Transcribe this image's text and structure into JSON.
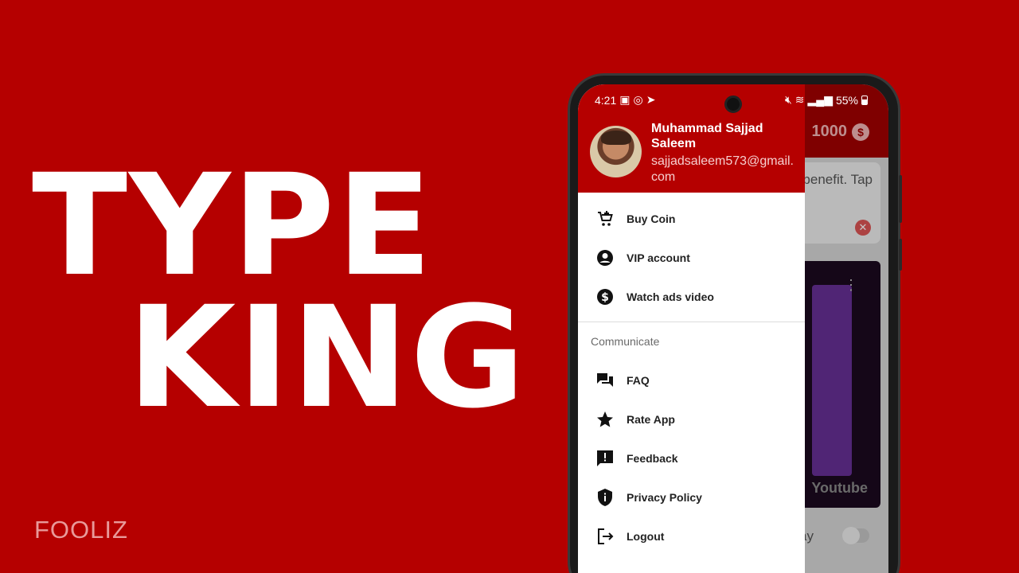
{
  "headline": {
    "line1": "TYPE",
    "line2": "KING"
  },
  "brand": "FOOLIZ",
  "status_bar": {
    "time": "4:21",
    "battery": "55%"
  },
  "background_app": {
    "coin_count": "1000",
    "coin_symbol": "$",
    "notice_text": "benefit. Tap",
    "autoplay_label": "o play",
    "video_channel": "Youtube"
  },
  "drawer": {
    "user": {
      "name": "Muhammad Sajjad Saleem",
      "email": "sajjadsaleem573@gmail.com"
    },
    "items": [
      {
        "label": "Buy Coin",
        "icon": "cart-add-icon"
      },
      {
        "label": "VIP account",
        "icon": "account-circle-icon"
      },
      {
        "label": "Watch ads video",
        "icon": "dollar-circle-icon"
      }
    ],
    "section_title": "Communicate",
    "communicate_items": [
      {
        "label": "FAQ",
        "icon": "chat-bubbles-icon"
      },
      {
        "label": "Rate App",
        "icon": "star-icon"
      },
      {
        "label": "Feedback",
        "icon": "feedback-icon"
      },
      {
        "label": "Privacy Policy",
        "icon": "shield-info-icon"
      },
      {
        "label": "Logout",
        "icon": "logout-icon"
      }
    ]
  },
  "colors": {
    "background": "#b50000",
    "drawer_header": "#b50000",
    "text_white": "#ffffff"
  }
}
